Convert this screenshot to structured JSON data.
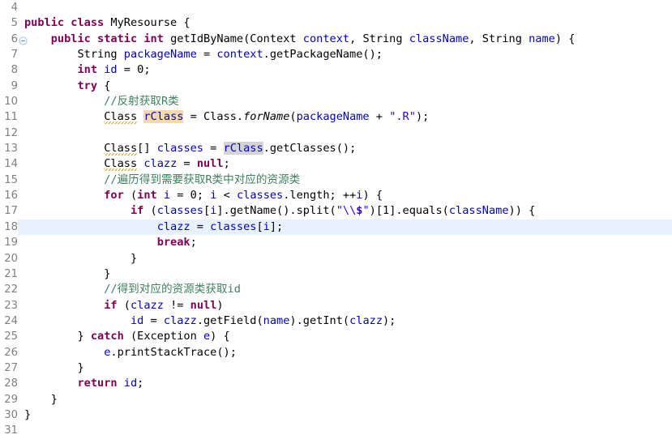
{
  "editor": {
    "app": "eclipse-java-editor",
    "language": "java",
    "class_name": "MyResourse",
    "current_line": 18,
    "first_visible_line": 4,
    "last_visible_line": 31,
    "colors": {
      "background": "#ffffff",
      "keyword": "#7f0055",
      "comment": "#3f7f5f",
      "string": "#2a00ff",
      "field": "#0000c0",
      "line_number": "#808080",
      "current_line_highlight": "#e8f2fe",
      "occurrence_write": "#f5d9a8",
      "occurrence_read": "#d4d4d4",
      "warning_squiggle": "#d6a400"
    },
    "lines": [
      {
        "n": "4",
        "fold": false,
        "current": false,
        "tokens": []
      },
      {
        "n": "5",
        "fold": false,
        "current": false,
        "tokens": [
          {
            "t": "public",
            "c": "kw"
          },
          {
            "t": " ",
            "c": "plain"
          },
          {
            "t": "class",
            "c": "kw"
          },
          {
            "t": " MyResourse {",
            "c": "plain"
          }
        ]
      },
      {
        "n": "6",
        "fold": true,
        "current": false,
        "tokens": [
          {
            "t": "    ",
            "c": "plain"
          },
          {
            "t": "public",
            "c": "kw"
          },
          {
            "t": " ",
            "c": "plain"
          },
          {
            "t": "static",
            "c": "kw"
          },
          {
            "t": " ",
            "c": "plain"
          },
          {
            "t": "int",
            "c": "kw"
          },
          {
            "t": " getIdByName(Context ",
            "c": "plain"
          },
          {
            "t": "context",
            "c": "fld"
          },
          {
            "t": ", String ",
            "c": "plain"
          },
          {
            "t": "className",
            "c": "fld"
          },
          {
            "t": ", String ",
            "c": "plain"
          },
          {
            "t": "name",
            "c": "fld"
          },
          {
            "t": ") {",
            "c": "plain"
          }
        ]
      },
      {
        "n": "7",
        "fold": false,
        "current": false,
        "tokens": [
          {
            "t": "        String ",
            "c": "plain"
          },
          {
            "t": "packageName",
            "c": "fld"
          },
          {
            "t": " = ",
            "c": "plain"
          },
          {
            "t": "context",
            "c": "fld"
          },
          {
            "t": ".getPackageName();",
            "c": "plain"
          }
        ]
      },
      {
        "n": "8",
        "fold": false,
        "current": false,
        "tokens": [
          {
            "t": "        ",
            "c": "plain"
          },
          {
            "t": "int",
            "c": "kw"
          },
          {
            "t": " ",
            "c": "plain"
          },
          {
            "t": "id",
            "c": "fld"
          },
          {
            "t": " = 0;",
            "c": "plain"
          }
        ]
      },
      {
        "n": "9",
        "fold": false,
        "current": false,
        "tokens": [
          {
            "t": "        ",
            "c": "plain"
          },
          {
            "t": "try",
            "c": "kw"
          },
          {
            "t": " {",
            "c": "plain"
          }
        ]
      },
      {
        "n": "10",
        "fold": false,
        "current": false,
        "tokens": [
          {
            "t": "            ",
            "c": "plain"
          },
          {
            "t": "//反射获取R类",
            "c": "cmt"
          }
        ]
      },
      {
        "n": "11",
        "fold": false,
        "current": false,
        "tokens": [
          {
            "t": "            ",
            "c": "plain"
          },
          {
            "t": "Class",
            "c": "plain warn"
          },
          {
            "t": " ",
            "c": "plain"
          },
          {
            "t": "rClass",
            "c": "fld occ-write"
          },
          {
            "t": " = Class.",
            "c": "plain"
          },
          {
            "t": "forName",
            "c": "plain stat"
          },
          {
            "t": "(",
            "c": "plain"
          },
          {
            "t": "packageName",
            "c": "fld"
          },
          {
            "t": " + ",
            "c": "plain"
          },
          {
            "t": "\".R\"",
            "c": "str"
          },
          {
            "t": ");",
            "c": "plain"
          }
        ]
      },
      {
        "n": "12",
        "fold": false,
        "current": false,
        "tokens": []
      },
      {
        "n": "13",
        "fold": false,
        "current": false,
        "tokens": [
          {
            "t": "            ",
            "c": "plain"
          },
          {
            "t": "Class",
            "c": "plain warn"
          },
          {
            "t": "[] ",
            "c": "plain"
          },
          {
            "t": "classes",
            "c": "fld"
          },
          {
            "t": " = ",
            "c": "plain"
          },
          {
            "t": "rClass",
            "c": "fld occ-read"
          },
          {
            "t": ".getClasses();",
            "c": "plain"
          }
        ]
      },
      {
        "n": "14",
        "fold": false,
        "current": false,
        "tokens": [
          {
            "t": "            ",
            "c": "plain"
          },
          {
            "t": "Class",
            "c": "plain warn"
          },
          {
            "t": " ",
            "c": "plain"
          },
          {
            "t": "clazz",
            "c": "fld"
          },
          {
            "t": " = ",
            "c": "plain"
          },
          {
            "t": "null",
            "c": "kw"
          },
          {
            "t": ";",
            "c": "plain"
          }
        ]
      },
      {
        "n": "15",
        "fold": false,
        "current": false,
        "tokens": [
          {
            "t": "            ",
            "c": "plain"
          },
          {
            "t": "//遍历得到需要获取R类中对应的资源类",
            "c": "cmt"
          }
        ]
      },
      {
        "n": "16",
        "fold": false,
        "current": false,
        "tokens": [
          {
            "t": "            ",
            "c": "plain"
          },
          {
            "t": "for",
            "c": "kw"
          },
          {
            "t": " (",
            "c": "plain"
          },
          {
            "t": "int",
            "c": "kw"
          },
          {
            "t": " ",
            "c": "plain"
          },
          {
            "t": "i",
            "c": "fld"
          },
          {
            "t": " = 0; ",
            "c": "plain"
          },
          {
            "t": "i",
            "c": "fld"
          },
          {
            "t": " < ",
            "c": "plain"
          },
          {
            "t": "classes",
            "c": "fld"
          },
          {
            "t": ".length; ++",
            "c": "plain"
          },
          {
            "t": "i",
            "c": "fld"
          },
          {
            "t": ") {",
            "c": "plain"
          }
        ]
      },
      {
        "n": "17",
        "fold": false,
        "current": false,
        "tokens": [
          {
            "t": "                ",
            "c": "plain"
          },
          {
            "t": "if",
            "c": "kw"
          },
          {
            "t": " (",
            "c": "plain"
          },
          {
            "t": "classes",
            "c": "fld"
          },
          {
            "t": "[",
            "c": "plain"
          },
          {
            "t": "i",
            "c": "fld"
          },
          {
            "t": "].getName().split(",
            "c": "plain"
          },
          {
            "t": "\"\\\\",
            "c": "str"
          },
          {
            "t": "$",
            "c": "strb"
          },
          {
            "t": "\"",
            "c": "str"
          },
          {
            "t": ")[1].equals(",
            "c": "plain"
          },
          {
            "t": "className",
            "c": "fld"
          },
          {
            "t": ")) {",
            "c": "plain"
          }
        ]
      },
      {
        "n": "18",
        "fold": false,
        "current": true,
        "tokens": [
          {
            "t": "                    ",
            "c": "plain"
          },
          {
            "t": "clazz",
            "c": "fld"
          },
          {
            "t": " = ",
            "c": "plain"
          },
          {
            "t": "classes",
            "c": "fld"
          },
          {
            "t": "[",
            "c": "plain"
          },
          {
            "t": "i",
            "c": "fld"
          },
          {
            "t": "];",
            "c": "plain"
          }
        ]
      },
      {
        "n": "19",
        "fold": false,
        "current": false,
        "tokens": [
          {
            "t": "                    ",
            "c": "plain"
          },
          {
            "t": "break",
            "c": "kw"
          },
          {
            "t": ";",
            "c": "plain"
          }
        ]
      },
      {
        "n": "20",
        "fold": false,
        "current": false,
        "tokens": [
          {
            "t": "                }",
            "c": "plain"
          }
        ]
      },
      {
        "n": "21",
        "fold": false,
        "current": false,
        "tokens": [
          {
            "t": "            }",
            "c": "plain"
          }
        ]
      },
      {
        "n": "22",
        "fold": false,
        "current": false,
        "tokens": [
          {
            "t": "            ",
            "c": "plain"
          },
          {
            "t": "//得到对应的资源类获取id",
            "c": "cmt"
          }
        ]
      },
      {
        "n": "23",
        "fold": false,
        "current": false,
        "tokens": [
          {
            "t": "            ",
            "c": "plain"
          },
          {
            "t": "if",
            "c": "kw"
          },
          {
            "t": " (",
            "c": "plain"
          },
          {
            "t": "clazz",
            "c": "fld"
          },
          {
            "t": " != ",
            "c": "plain"
          },
          {
            "t": "null",
            "c": "kw"
          },
          {
            "t": ")",
            "c": "plain"
          }
        ]
      },
      {
        "n": "24",
        "fold": false,
        "current": false,
        "tokens": [
          {
            "t": "                ",
            "c": "plain"
          },
          {
            "t": "id",
            "c": "fld"
          },
          {
            "t": " = ",
            "c": "plain"
          },
          {
            "t": "clazz",
            "c": "fld"
          },
          {
            "t": ".getField(",
            "c": "plain"
          },
          {
            "t": "name",
            "c": "fld"
          },
          {
            "t": ").getInt(",
            "c": "plain"
          },
          {
            "t": "clazz",
            "c": "fld"
          },
          {
            "t": ");",
            "c": "plain"
          }
        ]
      },
      {
        "n": "25",
        "fold": false,
        "current": false,
        "tokens": [
          {
            "t": "        } ",
            "c": "plain"
          },
          {
            "t": "catch",
            "c": "kw"
          },
          {
            "t": " (Exception ",
            "c": "plain"
          },
          {
            "t": "e",
            "c": "fld"
          },
          {
            "t": ") {",
            "c": "plain"
          }
        ]
      },
      {
        "n": "26",
        "fold": false,
        "current": false,
        "tokens": [
          {
            "t": "            ",
            "c": "plain"
          },
          {
            "t": "e",
            "c": "fld"
          },
          {
            "t": ".printStackTrace();",
            "c": "plain"
          }
        ]
      },
      {
        "n": "27",
        "fold": false,
        "current": false,
        "tokens": [
          {
            "t": "        }",
            "c": "plain"
          }
        ]
      },
      {
        "n": "28",
        "fold": false,
        "current": false,
        "tokens": [
          {
            "t": "        ",
            "c": "plain"
          },
          {
            "t": "return",
            "c": "kw"
          },
          {
            "t": " ",
            "c": "plain"
          },
          {
            "t": "id",
            "c": "fld"
          },
          {
            "t": ";",
            "c": "plain"
          }
        ]
      },
      {
        "n": "29",
        "fold": false,
        "current": false,
        "tokens": [
          {
            "t": "    }",
            "c": "plain"
          }
        ]
      },
      {
        "n": "30",
        "fold": false,
        "current": false,
        "tokens": [
          {
            "t": "}",
            "c": "plain"
          }
        ]
      },
      {
        "n": "31",
        "fold": false,
        "current": false,
        "tokens": []
      }
    ]
  }
}
